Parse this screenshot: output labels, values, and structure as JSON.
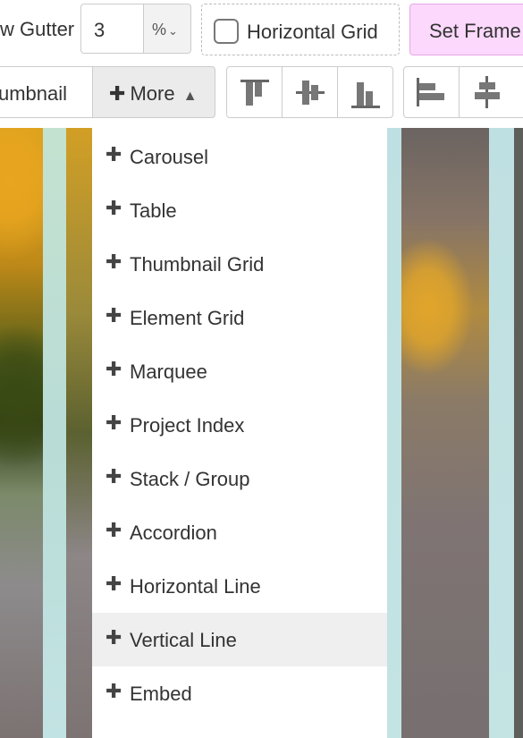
{
  "toolbar_row1": {
    "gutter_label": "w Gutter",
    "gutter_value": "3",
    "gutter_unit": "%",
    "horizontal_grid_label": "Horizontal Grid",
    "horizontal_grid_checked": false,
    "set_frame_label": "Set Frame"
  },
  "toolbar_row2": {
    "thumbnail_label": "umbnail",
    "more_label": "More",
    "align_icons": [
      "align-top-icon",
      "align-middle-icon",
      "align-bottom-icon",
      "align-left-icon",
      "align-center-icon"
    ]
  },
  "menu": {
    "items": [
      {
        "label": "Carousel"
      },
      {
        "label": "Table"
      },
      {
        "label": "Thumbnail Grid"
      },
      {
        "label": "Element Grid"
      },
      {
        "label": "Marquee"
      },
      {
        "label": "Project Index"
      },
      {
        "label": "Stack / Group"
      },
      {
        "label": "Accordion"
      },
      {
        "label": "Horizontal Line"
      },
      {
        "label": "Vertical Line"
      },
      {
        "label": "Embed"
      }
    ],
    "active_item": "Vertical Line"
  },
  "colors": {
    "set_frame_bg": "#fcd8fc",
    "menu_active_bg": "#efefef",
    "guide_column": "#c4e3e3"
  }
}
